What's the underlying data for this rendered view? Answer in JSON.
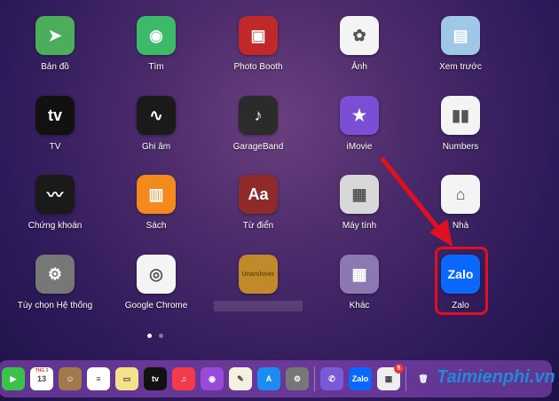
{
  "apps": [
    {
      "label": "Bản đồ",
      "icon": "maps-icon",
      "glyph": "➤",
      "bg": "#4cae5a"
    },
    {
      "label": "Tìm",
      "icon": "find-my-icon",
      "glyph": "◉",
      "bg": "#3cba6a"
    },
    {
      "label": "Photo Booth",
      "icon": "photo-booth-icon",
      "glyph": "▣",
      "bg": "#c0282a"
    },
    {
      "label": "Ảnh",
      "icon": "photos-icon",
      "glyph": "✿",
      "bg": "#f4f4f4"
    },
    {
      "label": "Xem trước",
      "icon": "preview-icon",
      "glyph": "▤",
      "bg": "#9fc8e8"
    },
    {
      "label": "TV",
      "icon": "tv-icon",
      "glyph": "tv",
      "bg": "#111"
    },
    {
      "label": "Ghi âm",
      "icon": "voice-memos-icon",
      "glyph": "∿",
      "bg": "#1a1a1a"
    },
    {
      "label": "GarageBand",
      "icon": "garageband-icon",
      "glyph": "♪",
      "bg": "#2b2b2b"
    },
    {
      "label": "iMovie",
      "icon": "imovie-icon",
      "glyph": "★",
      "bg": "#7a4fd6"
    },
    {
      "label": "Numbers",
      "icon": "numbers-icon",
      "glyph": "▮▮",
      "bg": "#f4f4f4"
    },
    {
      "label": "Chứng khoán",
      "icon": "stocks-icon",
      "glyph": "〰",
      "bg": "#1a1a1a"
    },
    {
      "label": "Sách",
      "icon": "books-icon",
      "glyph": "▥",
      "bg": "#f28a1c"
    },
    {
      "label": "Từ điển",
      "icon": "dictionary-icon",
      "glyph": "Aa",
      "bg": "#8e2a2a"
    },
    {
      "label": "Máy tính",
      "icon": "calculator-icon",
      "glyph": "▦",
      "bg": "#d8d8d8"
    },
    {
      "label": "Nhà",
      "icon": "home-icon",
      "glyph": "⌂",
      "bg": "#f4f4f4"
    },
    {
      "label": "Tùy chọn Hệ thống",
      "icon": "system-preferences-icon",
      "glyph": "⚙",
      "bg": "#777"
    },
    {
      "label": "Google Chrome",
      "icon": "chrome-icon",
      "glyph": "◎",
      "bg": "#f4f4f4"
    },
    {
      "label": "",
      "icon": "unarchiver-icon",
      "glyph": "Unarchiver",
      "bg": "#c08a2a"
    },
    {
      "label": "Khác",
      "icon": "other-folder-icon",
      "glyph": "▦",
      "bg": "#8a7ab0"
    },
    {
      "label": "Zalo",
      "icon": "zalo-icon",
      "glyph": "Zalo",
      "bg": "#0a68ff"
    }
  ],
  "dock": [
    {
      "name": "facetime",
      "glyph": "▶",
      "bg": "#3ac24a"
    },
    {
      "name": "calendar",
      "glyph": "13",
      "bg": "#fff",
      "month": "THG 3"
    },
    {
      "name": "contacts",
      "glyph": "☺",
      "bg": "#a07a4a"
    },
    {
      "name": "reminders",
      "glyph": "≡",
      "bg": "#fff"
    },
    {
      "name": "notes",
      "glyph": "▭",
      "bg": "#f6e28a"
    },
    {
      "name": "apple-tv",
      "glyph": "tv",
      "bg": "#111"
    },
    {
      "name": "music",
      "glyph": "♫",
      "bg": "#f23a4a"
    },
    {
      "name": "podcasts",
      "glyph": "◉",
      "bg": "#9a4ad8"
    },
    {
      "name": "pages",
      "glyph": "✎",
      "bg": "#f6f0e0"
    },
    {
      "name": "app-store",
      "glyph": "A",
      "bg": "#1c8cf2"
    },
    {
      "name": "system-preferences",
      "glyph": "⚙",
      "bg": "#777"
    },
    {
      "name": "viber",
      "glyph": "✆",
      "bg": "#7a5ad8"
    },
    {
      "name": "zalo",
      "glyph": "Zalo",
      "bg": "#0a68ff"
    },
    {
      "name": "microsoft-installer",
      "glyph": "▦",
      "bg": "#eee",
      "badge": "5"
    },
    {
      "name": "trash",
      "glyph": "🗑",
      "bg": "transparent"
    }
  ],
  "watermark": "Taimienphi.vn"
}
